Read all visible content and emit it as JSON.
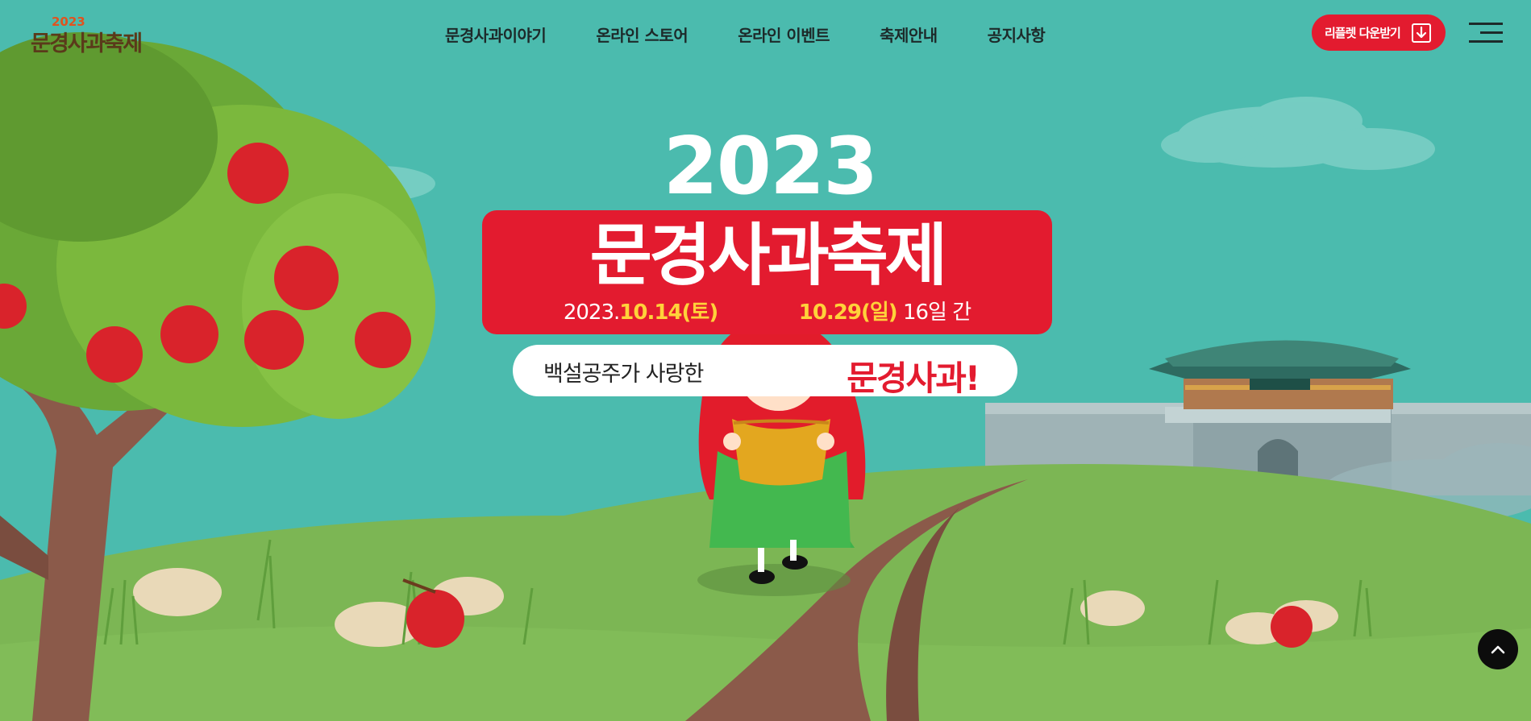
{
  "header": {
    "logo": {
      "year": "2023",
      "name": "문경사과축제"
    },
    "nav": [
      {
        "label": "문경사과이야기"
      },
      {
        "label": "온라인 스토어"
      },
      {
        "label": "온라인 이벤트"
      },
      {
        "label": "축제안내"
      },
      {
        "label": "공지사항"
      }
    ],
    "leaflet_button": {
      "label": "리플렛 다운받기",
      "icon": "download-icon"
    },
    "menu_icon": "hamburger-menu-icon"
  },
  "hero": {
    "year": "2023",
    "title": "문경사과축제",
    "dates": {
      "start_prefix": "2023.",
      "start": "10.14(토)",
      "end": "10.29(일)",
      "duration": "16일 간"
    },
    "tagline": {
      "left": "백설공주가 사랑한",
      "right": "문경사과!"
    }
  },
  "scroll_top_button": {
    "icon": "chevron-up-icon"
  },
  "colors": {
    "sky": "#4bbbae",
    "brand_red": "#e31b2f",
    "grass": "#7cb654",
    "path": "#8b5a4a",
    "date_yellow": "#ffd23a"
  }
}
